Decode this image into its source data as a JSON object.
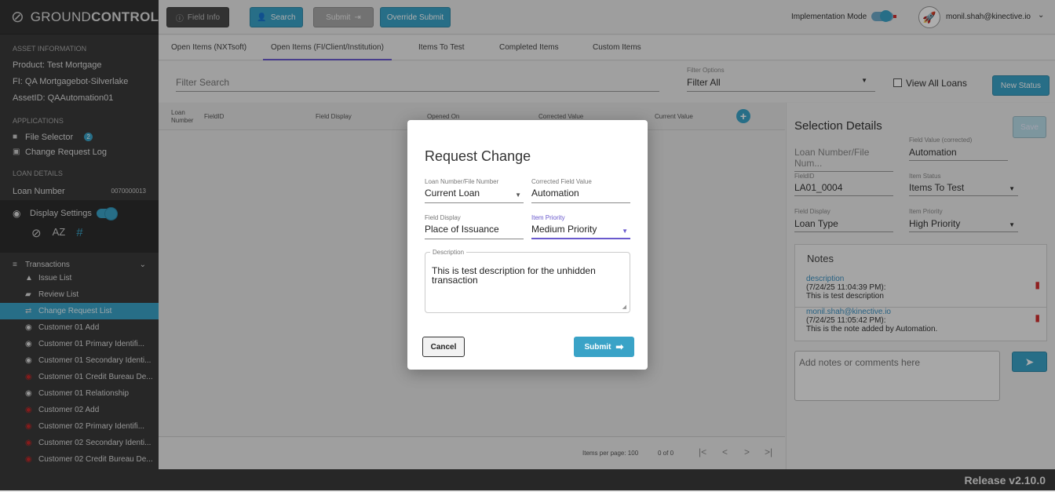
{
  "app": {
    "logo_prefix": "GROUND",
    "logo_bold": "CONTROL",
    "release": "Release v2.10.0"
  },
  "topbar": {
    "field_info": "Field Info",
    "search": "Search",
    "submit": "Submit",
    "override_submit": "Override Submit",
    "impl_mode": "Implementation Mode",
    "user": "monil.shah@kinective.io"
  },
  "sidebar": {
    "asset_title": "ASSET INFORMATION",
    "product": "Product:  Test Mortgage",
    "fi": "FI:  QA Mortgagebot-Silverlake",
    "asset_id": "AssetID:  QAAutomation01",
    "apps_title": "APPLICATIONS",
    "file_selector": "File Selector",
    "file_selector_badge": "2",
    "change_log": "Change Request Log",
    "loan_title": "LOAN DETAILS",
    "loan_label": "Loan Number",
    "loan_value": "0070000013",
    "display_settings": "Display Settings",
    "transactions": "Transactions",
    "items": [
      {
        "label": "Issue List",
        "icon": "warning-icon"
      },
      {
        "label": "Review List",
        "icon": "review-icon"
      },
      {
        "label": "Change Request List",
        "icon": "change-icon"
      },
      {
        "label": "Customer 01 Add",
        "icon": "eye-icon"
      },
      {
        "label": "Customer 01 Primary Identifi...",
        "icon": "eye-icon"
      },
      {
        "label": "Customer 01 Secondary Identi...",
        "icon": "eye-icon"
      },
      {
        "label": "Customer 01 Credit Bureau De...",
        "icon": "eye-hidden-icon"
      },
      {
        "label": "Customer 01 Relationship",
        "icon": "eye-icon"
      },
      {
        "label": "Customer 02 Add",
        "icon": "eye-hidden-icon"
      },
      {
        "label": "Customer 02 Primary Identifi...",
        "icon": "eye-hidden-icon"
      },
      {
        "label": "Customer 02 Secondary Identi...",
        "icon": "eye-hidden-icon"
      },
      {
        "label": "Customer 02 Credit Bureau De...",
        "icon": "eye-hidden-icon"
      }
    ]
  },
  "tabs": [
    "Open Items (NXTsoft)",
    "Open Items (FI/Client/Institution)",
    "Items To Test",
    "Completed Items",
    "Custom Items"
  ],
  "filter": {
    "search_placeholder": "Filter Search",
    "options_label": "Filter Options",
    "options_value": "Filter All",
    "view_all": "View All Loans",
    "new_status": "New Status"
  },
  "grid": {
    "columns": [
      "Loan Number",
      "FieldID",
      "Field Display",
      "Opened On",
      "Corrected Value",
      "Current Value"
    ],
    "items_per_page": "Items per page: 100",
    "range": "0 of 0"
  },
  "details": {
    "title": "Selection Details",
    "save": "Save",
    "loan_placeholder": "Loan Number/File Num...",
    "field_value_label": "Field Value (corrected)",
    "field_value": "Automation",
    "fieldid_label": "FieldID",
    "fieldid": "LA01_0004",
    "status_label": "Item Status",
    "status": "Items To Test",
    "display_label": "Field Display",
    "display": "Loan Type",
    "priority_label": "Item Priority",
    "priority": "High Priority",
    "notes_title": "Notes",
    "notes": [
      {
        "author": "description",
        "time": "(7/24/25 11:04:39 PM):",
        "text": "This is test description"
      },
      {
        "author": "monil.shah@kinective.io",
        "time": "(7/24/25 11:05:42 PM):",
        "text": "This is the note added by Automation."
      }
    ],
    "notes_placeholder": "Add notes or comments here"
  },
  "modal": {
    "title": "Request Change",
    "loan_label": "Loan Number/File Number",
    "loan_value": "Current Loan",
    "corrected_label": "Corrected Field Value",
    "corrected_value": "Automation",
    "display_label": "Field Display",
    "display_value": "Place of Issuance",
    "priority_label": "Item Priority",
    "priority_value": "Medium Priority",
    "desc_label": "Description",
    "desc_value": "This is test description for the unhidden transaction",
    "cancel": "Cancel",
    "submit": "Submit"
  },
  "colors": {
    "accent": "#3aa3c7",
    "sidebar": "#3a3a3a",
    "danger": "#d32f2f",
    "tab_active": "#6a5acd"
  }
}
